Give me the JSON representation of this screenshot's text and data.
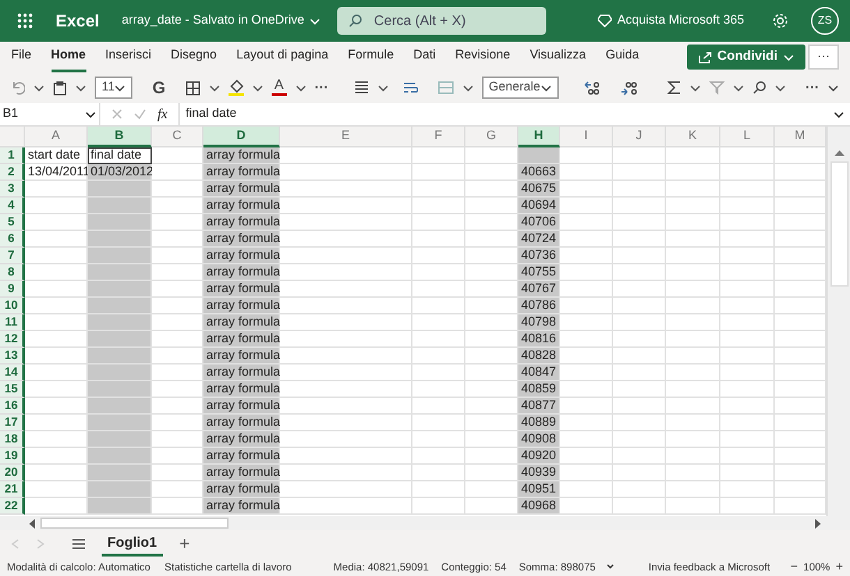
{
  "header": {
    "app": "Excel",
    "document": "array_date",
    "save_status": "- Salvato in OneDrive",
    "search": {
      "placeholder": "Cerca (Alt + X)"
    },
    "buy": "Acquista Microsoft 365",
    "avatar": "ZS"
  },
  "ribbon_tabs": [
    {
      "label": "File",
      "selected": false
    },
    {
      "label": "Home",
      "selected": true
    },
    {
      "label": "Inserisci",
      "selected": false
    },
    {
      "label": "Disegno",
      "selected": false
    },
    {
      "label": "Layout di pagina",
      "selected": false
    },
    {
      "label": "Formule",
      "selected": false
    },
    {
      "label": "Dati",
      "selected": false
    },
    {
      "label": "Revisione",
      "selected": false
    },
    {
      "label": "Visualizza",
      "selected": false
    },
    {
      "label": "Guida",
      "selected": false
    }
  ],
  "share_button": "Condividi",
  "more_button": "···",
  "toolbar": {
    "font_size": "11",
    "bold": "G",
    "font_color": "A",
    "more": "···",
    "number_format": "Generale",
    "more_end": "···"
  },
  "formula_bar": {
    "name_box": "B1",
    "fx": "fx",
    "formula": "final date"
  },
  "columns": [
    {
      "label": "A",
      "selected": false
    },
    {
      "label": "B",
      "selected": true
    },
    {
      "label": "C",
      "selected": false
    },
    {
      "label": "D",
      "selected": true
    },
    {
      "label": "E",
      "selected": false
    },
    {
      "label": "F",
      "selected": false
    },
    {
      "label": "G",
      "selected": false
    },
    {
      "label": "H",
      "selected": true
    },
    {
      "label": "I",
      "selected": false
    },
    {
      "label": "J",
      "selected": false
    },
    {
      "label": "K",
      "selected": false
    },
    {
      "label": "L",
      "selected": false
    },
    {
      "label": "M",
      "selected": false
    }
  ],
  "rows": [
    {
      "label": "1",
      "cells": {
        "A": {
          "text": "start date",
          "active": false
        },
        "B": {
          "text": "final date",
          "active": true
        },
        "D": {
          "text": "array formula",
          "active": false
        }
      }
    },
    {
      "label": "2",
      "cells": {
        "A": {
          "text": "13/04/2011",
          "active": false
        },
        "B": {
          "text": "01/03/2012",
          "active": false
        },
        "D": {
          "text": "array formula",
          "active": false
        },
        "H": {
          "text": "40663",
          "active": false
        }
      }
    },
    {
      "label": "3",
      "cells": {
        "D": {
          "text": "array formula",
          "active": false
        },
        "H": {
          "text": "40675",
          "active": false
        }
      }
    },
    {
      "label": "4",
      "cells": {
        "D": {
          "text": "array formula",
          "active": false
        },
        "H": {
          "text": "40694",
          "active": false
        }
      }
    },
    {
      "label": "5",
      "cells": {
        "D": {
          "text": "array formula",
          "active": false
        },
        "H": {
          "text": "40706",
          "active": false
        }
      }
    },
    {
      "label": "6",
      "cells": {
        "D": {
          "text": "array formula",
          "active": false
        },
        "H": {
          "text": "40724",
          "active": false
        }
      }
    },
    {
      "label": "7",
      "cells": {
        "D": {
          "text": "array formula",
          "active": false
        },
        "H": {
          "text": "40736",
          "active": false
        }
      }
    },
    {
      "label": "8",
      "cells": {
        "D": {
          "text": "array formula",
          "active": false
        },
        "H": {
          "text": "40755",
          "active": false
        }
      }
    },
    {
      "label": "9",
      "cells": {
        "D": {
          "text": "array formula",
          "active": false
        },
        "H": {
          "text": "40767",
          "active": false
        }
      }
    },
    {
      "label": "10",
      "cells": {
        "D": {
          "text": "array formula",
          "active": false
        },
        "H": {
          "text": "40786",
          "active": false
        }
      }
    },
    {
      "label": "11",
      "cells": {
        "D": {
          "text": "array formula",
          "active": false
        },
        "H": {
          "text": "40798",
          "active": false
        }
      }
    },
    {
      "label": "12",
      "cells": {
        "D": {
          "text": "array formula",
          "active": false
        },
        "H": {
          "text": "40816",
          "active": false
        }
      }
    },
    {
      "label": "13",
      "cells": {
        "D": {
          "text": "array formula",
          "active": false
        },
        "H": {
          "text": "40828",
          "active": false
        }
      }
    },
    {
      "label": "14",
      "cells": {
        "D": {
          "text": "array formula",
          "active": false
        },
        "H": {
          "text": "40847",
          "active": false
        }
      }
    },
    {
      "label": "15",
      "cells": {
        "D": {
          "text": "array formula",
          "active": false
        },
        "H": {
          "text": "40859",
          "active": false
        }
      }
    },
    {
      "label": "16",
      "cells": {
        "D": {
          "text": "array formula",
          "active": false
        },
        "H": {
          "text": "40877",
          "active": false
        }
      }
    },
    {
      "label": "17",
      "cells": {
        "D": {
          "text": "array formula",
          "active": false
        },
        "H": {
          "text": "40889",
          "active": false
        }
      }
    },
    {
      "label": "18",
      "cells": {
        "D": {
          "text": "array formula",
          "active": false
        },
        "H": {
          "text": "40908",
          "active": false
        }
      }
    },
    {
      "label": "19",
      "cells": {
        "D": {
          "text": "array formula",
          "active": false
        },
        "H": {
          "text": "40920",
          "active": false
        }
      }
    },
    {
      "label": "20",
      "cells": {
        "D": {
          "text": "array formula",
          "active": false
        },
        "H": {
          "text": "40939",
          "active": false
        }
      }
    },
    {
      "label": "21",
      "cells": {
        "D": {
          "text": "array formula",
          "active": false
        },
        "H": {
          "text": "40951",
          "active": false
        }
      }
    },
    {
      "label": "22",
      "cells": {
        "D": {
          "text": "array formula",
          "active": false
        },
        "H": {
          "text": "40968",
          "active": false
        }
      }
    }
  ],
  "sheet_tabs": [
    {
      "label": "Foglio1",
      "selected": true
    }
  ],
  "add_sheet": "+",
  "status_bar": {
    "calc_mode": "Modalità di calcolo: Automatico",
    "workbook_stats": "Statistiche cartella di lavoro",
    "average": "Media: 40821,59091",
    "count": "Conteggio: 54",
    "sum": "Somma: 898075",
    "feedback": "Invia feedback a Microsoft",
    "zoom_out": "−",
    "zoom": "100%",
    "zoom_in": "+"
  }
}
